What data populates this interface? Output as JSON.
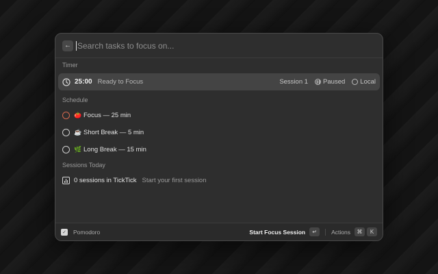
{
  "search": {
    "placeholder": "Search tasks to focus on..."
  },
  "timer": {
    "section": "Timer",
    "time": "25:00",
    "status": "Ready to Focus",
    "session": "Session 1",
    "state": "Paused",
    "scope": "Local"
  },
  "schedule": {
    "section": "Schedule",
    "items": [
      {
        "label": "Focus — 25 min",
        "icon": "tomato-icon",
        "emoji": "🍅",
        "active": true
      },
      {
        "label": "Short Break — 5 min",
        "icon": "coffee-icon",
        "emoji": "☕",
        "active": false
      },
      {
        "label": "Long Break — 15 min",
        "icon": "leaf-icon",
        "emoji": "🌿",
        "active": false
      }
    ]
  },
  "sessions": {
    "section": "Sessions Today",
    "main": "0 sessions in TickTick",
    "sub": "Start your first session"
  },
  "footer": {
    "app_name": "Pomodoro",
    "primary_action": "Start Focus Session",
    "enter_key": "↵",
    "actions_label": "Actions",
    "cmd_key": "⌘",
    "k_key": "K"
  },
  "colors": {
    "accent": "#d4694f",
    "panel": "#2e2e2e",
    "selected": "#444444"
  }
}
